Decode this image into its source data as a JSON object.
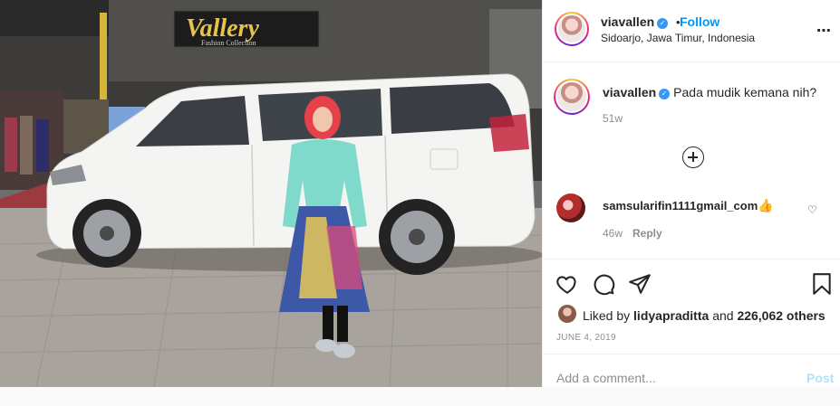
{
  "header": {
    "username": "viavallen",
    "verified_mark": "✓",
    "separator": "•",
    "follow_label": "Follow",
    "location": "Sidoarjo, Jawa Timur, Indonesia",
    "more_icon": "⋯"
  },
  "photo": {
    "store_sign": "Vallery",
    "store_sign_sub": "Fashion Collection",
    "description_icon": "photo-of-woman-next-to-white-van"
  },
  "caption": {
    "username": "viavallen",
    "verified_mark": "✓",
    "text": "Pada mudik kemana nih?",
    "time": "51w"
  },
  "load_more_icon": "plus-circle-icon",
  "comments": [
    {
      "username": "samsularifin1111gmail_com",
      "emoji": "👍",
      "time": "46w",
      "reply_label": "Reply",
      "heart_icon": "♡"
    }
  ],
  "actions": {
    "icons": [
      "heart-icon",
      "comment-icon",
      "share-icon",
      "bookmark-icon"
    ]
  },
  "likes": {
    "prefix": "Liked by",
    "user": "lidyapraditta",
    "joiner": "and",
    "others": "226,062 others"
  },
  "post_date": "JUNE 4, 2019",
  "comment_box": {
    "placeholder": "Add a comment...",
    "post_label": "Post"
  },
  "colors": {
    "accent": "#0095f6",
    "post_disabled": "#b2dffc",
    "muted": "#8e8e8e",
    "text": "#262626"
  }
}
